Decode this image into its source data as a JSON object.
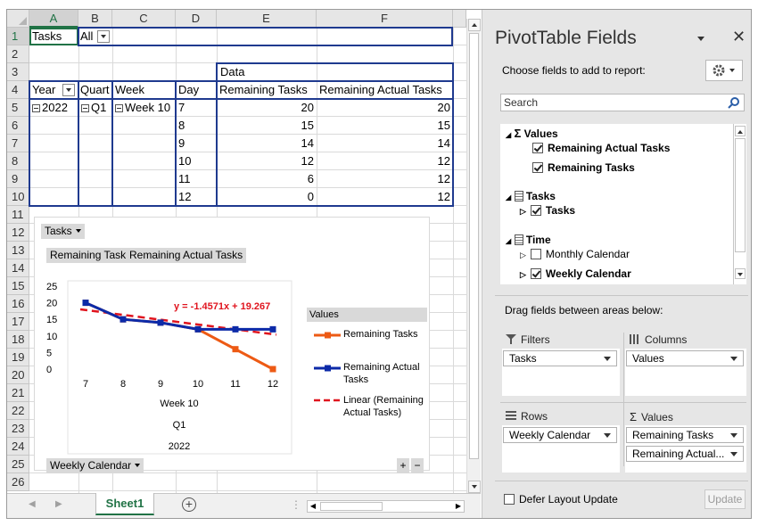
{
  "columns": [
    "A",
    "B",
    "C",
    "D",
    "E",
    "F"
  ],
  "rows": [
    "1",
    "2",
    "3",
    "4",
    "5",
    "6",
    "7",
    "8",
    "9",
    "10",
    "11",
    "12",
    "13",
    "14",
    "15",
    "16",
    "17",
    "18",
    "19",
    "20",
    "21",
    "22",
    "23",
    "24",
    "25",
    "26"
  ],
  "pivot": {
    "filter_field": "Tasks",
    "filter_value": "All",
    "data_label": "Data",
    "headers": [
      "Year",
      "Quart",
      "Week",
      "Day",
      "Remaining Tasks",
      "Remaining Actual Tasks"
    ],
    "year": "2022",
    "quarter": "Q1",
    "week": "Week 10",
    "days": [
      "7",
      "8",
      "9",
      "10",
      "11",
      "12"
    ],
    "remaining": [
      "20",
      "15",
      "14",
      "12",
      "6",
      "0"
    ],
    "remaining_actual": [
      "20",
      "15",
      "14",
      "12",
      "12",
      "12"
    ]
  },
  "chart_buttons": {
    "tasks": "Tasks",
    "val1": "Remaining Tasks",
    "val2": "Remaining Actual Tasks",
    "axis": "Weekly Calendar",
    "plus": "+",
    "minus": "−"
  },
  "chart_data": {
    "type": "line",
    "categories": [
      "7",
      "8",
      "9",
      "10",
      "11",
      "12"
    ],
    "axis_groups": [
      "Week 10",
      "Q1",
      "2022"
    ],
    "ylim": [
      0,
      25
    ],
    "yticks": [
      "25",
      "20",
      "15",
      "10",
      "5",
      "0"
    ],
    "series": [
      {
        "name": "Remaining Tasks",
        "values": [
          20,
          15,
          14,
          12,
          6,
          0
        ],
        "color": "#ed5a14"
      },
      {
        "name": "Remaining Actual Tasks",
        "values": [
          20,
          15,
          14,
          12,
          12,
          12
        ],
        "color": "#0c2aa8"
      }
    ],
    "trendline": {
      "name": "Linear (Remaining Actual Tasks)",
      "slope": -1.4571,
      "intercept": 19.267,
      "color": "#e0141e",
      "equation": "y = -1.4571x + 19.267"
    },
    "legend_title": "Values",
    "legend_items": [
      "Remaining Tasks",
      "Remaining Actual Tasks",
      "Linear (Remaining Actual Tasks)"
    ]
  },
  "sheet_tab": "Sheet1",
  "panel": {
    "title": "PivotTable Fields",
    "subtitle": "Choose fields to add to report:",
    "search_placeholder": "Search",
    "groups": {
      "values": "Values",
      "values_items": [
        "Remaining Actual Tasks",
        "Remaining Tasks"
      ],
      "tasks": "Tasks",
      "tasks_item": "Tasks",
      "time": "Time",
      "time_items": [
        "Monthly Calendar",
        "Weekly Calendar"
      ]
    },
    "drag_label": "Drag fields between areas below:",
    "areas": {
      "filters": "Filters",
      "columns": "Columns",
      "rows": "Rows",
      "values": "Values",
      "filters_field": "Tasks",
      "columns_field": "Values",
      "rows_field": "Weekly Calendar",
      "values_fields": [
        "Remaining Tasks",
        "Remaining Actual..."
      ]
    },
    "defer_label": "Defer Layout Update",
    "update_label": "Update"
  }
}
